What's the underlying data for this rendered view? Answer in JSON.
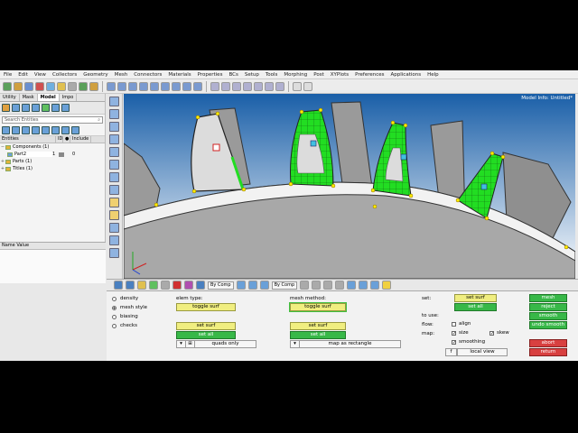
{
  "menu": [
    "File",
    "Edit",
    "View",
    "Collectors",
    "Geometry",
    "Mesh",
    "Connectors",
    "Materials",
    "Properties",
    "BCs",
    "Setup",
    "Tools",
    "Morphing",
    "Post",
    "XYPlots",
    "Preferences",
    "Applications",
    "Help"
  ],
  "left_tabs": [
    "Utility",
    "Mask",
    "Model",
    "Impo"
  ],
  "search_placeholder": "Search Entities",
  "tree_headers": {
    "entities": "Entities",
    "id": "ID",
    "include": "Include"
  },
  "tree": [
    {
      "label": "Components (1)",
      "id": "",
      "include": ""
    },
    {
      "label": "Part2",
      "id": "1",
      "include": "0"
    },
    {
      "label": "Parts (1)",
      "id": "",
      "include": ""
    },
    {
      "label": "Titles (1)",
      "id": "",
      "include": ""
    }
  ],
  "name_value_header": "Name Value",
  "viewport": {
    "model_info": "Model Info: Untitled*"
  },
  "btoolbar": {
    "by_comp_1": "By Comp",
    "by_comp_2": "By Comp"
  },
  "panel": {
    "radios": [
      "density",
      "mesh style",
      "biasing",
      "checks"
    ],
    "selected_radio": "mesh style",
    "elem_type_label": "elem type:",
    "toggle_surf_1": "toggle surf",
    "set_surf_1": "set surf",
    "set_all_1": "set all",
    "quads_only": "quads only",
    "mesh_method_label": "mesh method:",
    "toggle_surf_2": "toggle surf",
    "set_surf_2": "set surf",
    "set_all_2": "set all",
    "map_as_rectangle": "map as rectangle",
    "set_label": "set:",
    "set_surf_3": "set surf",
    "set_all_3": "set all",
    "to_use_label": "to use:",
    "flow_label": "flow:",
    "align_label": "align",
    "map_label": "map:",
    "size_label": "size",
    "skew_label": "skew",
    "smoothing_label": "smoothing",
    "f_label": "f",
    "local_view": "local view",
    "mesh": "mesh",
    "reject": "reject",
    "smooth": "smooth",
    "undo_smooth": "undo smooth",
    "abort": "abort",
    "return": "return"
  },
  "colors": {
    "viewport_top": "#1a5fa8",
    "viewport_bottom": "#ffffff",
    "mesh_green": "#22dd22",
    "button_yellow": "#f0ee80",
    "button_green": "#38b848",
    "button_red": "#d84040"
  }
}
